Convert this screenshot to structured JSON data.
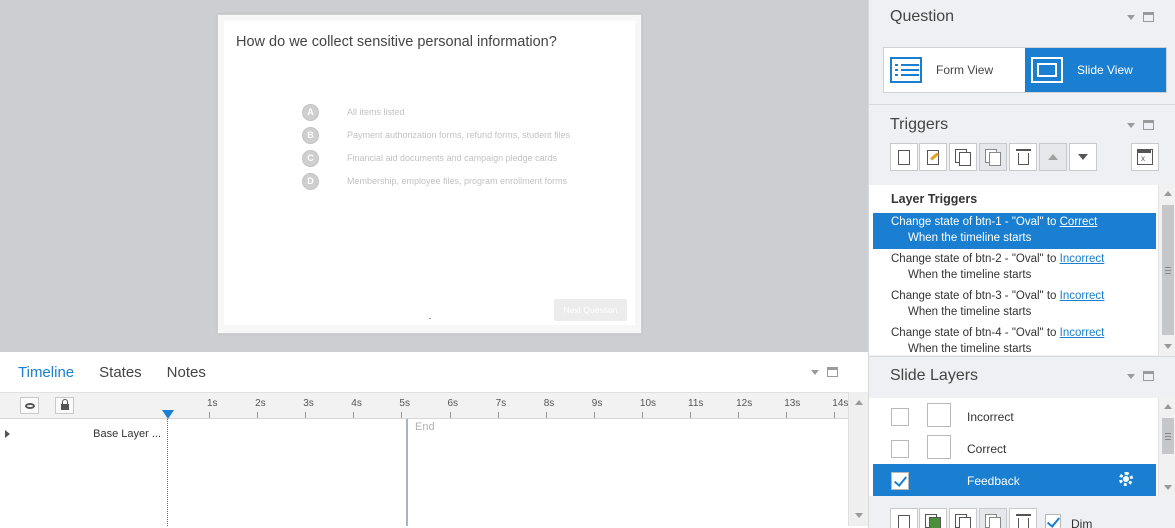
{
  "slide": {
    "question": "How do we collect sensitive personal information?",
    "choices": [
      {
        "letter": "A",
        "text": "All items listed"
      },
      {
        "letter": "B",
        "text": "Payment authorization forms, refund forms, student files"
      },
      {
        "letter": "C",
        "text": "Financial aid documents and campaign pledge cards"
      },
      {
        "letter": "D",
        "text": "Membership, employee files, program enrollment forms"
      }
    ],
    "next_button": "Next Question"
  },
  "timeline": {
    "tabs": [
      "Timeline",
      "States",
      "Notes"
    ],
    "active_tab": "Timeline",
    "ticks": [
      "1s",
      "2s",
      "3s",
      "4s",
      "5s",
      "6s",
      "7s",
      "8s",
      "9s",
      "10s",
      "11s",
      "12s",
      "13s",
      "14s"
    ],
    "layer_name": "Base Layer ...",
    "end_label": "End"
  },
  "sidebar": {
    "question": {
      "title": "Question",
      "form_view": "Form View",
      "slide_view": "Slide View",
      "active_view": "Slide View"
    },
    "triggers": {
      "title": "Triggers",
      "header": "Layer Triggers",
      "items": [
        {
          "prefix": "Change state of btn-1 - \"Oval\" to ",
          "link": "Correct",
          "when": "When the timeline starts",
          "selected": true
        },
        {
          "prefix": "Change state of btn-2 - \"Oval\" to ",
          "link": "Incorrect",
          "when": "When the timeline starts",
          "selected": false
        },
        {
          "prefix": "Change state of btn-3 - \"Oval\" to ",
          "link": "Incorrect",
          "when": "When the timeline starts",
          "selected": false
        },
        {
          "prefix": "Change state of btn-4 - \"Oval\" to ",
          "link": "Incorrect",
          "when": "When the timeline starts",
          "selected": false
        }
      ]
    },
    "slide_layers": {
      "title": "Slide Layers",
      "items": [
        {
          "name": "Incorrect",
          "checked": false,
          "selected": false
        },
        {
          "name": "Correct",
          "checked": false,
          "selected": false
        },
        {
          "name": "Feedback",
          "checked": true,
          "selected": true
        }
      ],
      "dim_label": "Dim",
      "dim_checked": true
    }
  },
  "colors": {
    "accent": "#1a7fd0",
    "stage_bg": "#ccced2",
    "sidebar_bg": "#eef0f3"
  }
}
